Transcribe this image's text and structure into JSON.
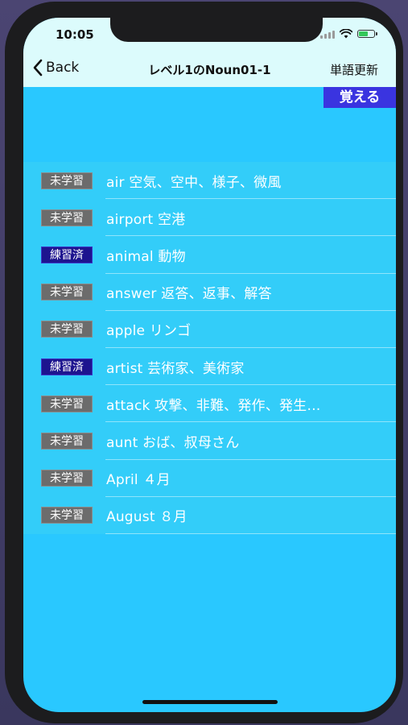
{
  "status_bar": {
    "time": "10:05",
    "icons": [
      "cellular-signal-icon",
      "wifi-icon",
      "battery-charging-icon"
    ],
    "battery_color": "#34c759"
  },
  "nav": {
    "back_label": "Back",
    "title": "レベル1のNoun01-1",
    "right_label": "単語更新"
  },
  "memorize_button": {
    "label": "覚える",
    "color": "#3a34e0"
  },
  "colors": {
    "background": "#29c8ff",
    "list_background": "#33cdf9",
    "nav_background": "#dcfbfc",
    "unlearned_badge": "#6c6c6c",
    "practiced_badge": "#1d148f"
  },
  "words": [
    {
      "status": "未学習",
      "status_type": "unlearned",
      "text": "air 空気、空中、様子、微風"
    },
    {
      "status": "未学習",
      "status_type": "unlearned",
      "text": "airport 空港"
    },
    {
      "status": "練習済",
      "status_type": "practiced",
      "text": "animal 動物"
    },
    {
      "status": "未学習",
      "status_type": "unlearned",
      "text": "answer 返答、返事、解答"
    },
    {
      "status": "未学習",
      "status_type": "unlearned",
      "text": "apple リンゴ"
    },
    {
      "status": "練習済",
      "status_type": "practiced",
      "text": "artist 芸術家、美術家"
    },
    {
      "status": "未学習",
      "status_type": "unlearned",
      "text": "attack 攻撃、非難、発作、発生…"
    },
    {
      "status": "未学習",
      "status_type": "unlearned",
      "text": "aunt おば、叔母さん"
    },
    {
      "status": "未学習",
      "status_type": "unlearned",
      "text": "April ４月"
    },
    {
      "status": "未学習",
      "status_type": "unlearned",
      "text": "August ８月"
    }
  ]
}
